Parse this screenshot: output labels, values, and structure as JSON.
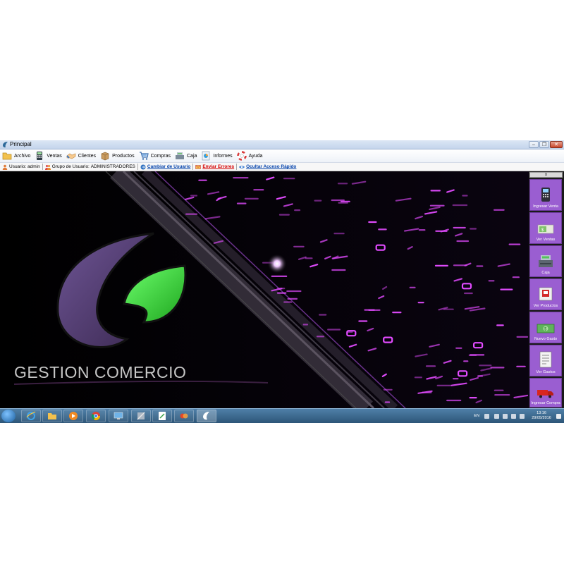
{
  "window": {
    "title": "Principal"
  },
  "menu": [
    {
      "label": "Archivo",
      "icon": "folder-icon"
    },
    {
      "label": "Ventas",
      "icon": "calculator-icon"
    },
    {
      "label": "Clientes",
      "icon": "handshake-icon"
    },
    {
      "label": "Productos",
      "icon": "box-icon"
    },
    {
      "label": "Compras",
      "icon": "cart-icon"
    },
    {
      "label": "Caja",
      "icon": "cashbox-icon"
    },
    {
      "label": "Informes",
      "icon": "report-icon"
    },
    {
      "label": "Ayuda",
      "icon": "lifebuoy-icon"
    }
  ],
  "info": {
    "user_label": "Usuario:",
    "user_value": "admin",
    "group_label": "Grupo de Usuario:",
    "group_value": "ADMINISTRADORES",
    "change_user": "Cambiar de Usuario",
    "send_errors": "Enviar Errores",
    "hide_quick": "Ocultar Acceso Rápido"
  },
  "branding": {
    "logo_text": "GESTION COMERCIO"
  },
  "quick_access": {
    "close_label": "x",
    "items": [
      {
        "label": "Ingresar Venta",
        "icon": "pos-terminal-icon"
      },
      {
        "label": "Ver Ventas",
        "icon": "receipt-money-icon"
      },
      {
        "label": "Caja",
        "icon": "cash-register-icon"
      },
      {
        "label": "Ver Productos",
        "icon": "product-catalog-icon"
      },
      {
        "label": "Nuevo Gasto",
        "icon": "money-bill-icon"
      },
      {
        "label": "Ver Gastos",
        "icon": "ledger-icon"
      },
      {
        "label": "Ingresar Compra",
        "icon": "truck-icon"
      }
    ]
  },
  "taskbar": {
    "lang": "EN",
    "time": "13:16",
    "date": "29/05/2016"
  },
  "colors": {
    "accent_purple": "#9a5ed1",
    "logo_purple": "#5a3d7a",
    "logo_green": "#3ecf3e",
    "neon": "#e24bff"
  }
}
